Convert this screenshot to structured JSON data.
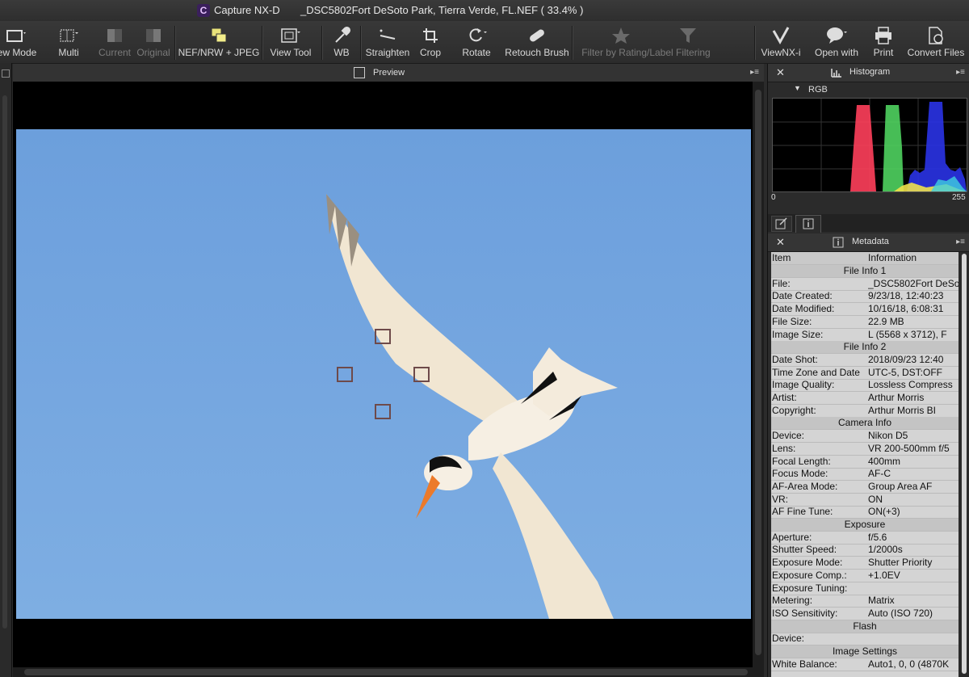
{
  "window": {
    "app_name": "Capture NX-D",
    "title": "_DSC5802Fort DeSoto Park, Tierra Verde, FL.NEF ( 33.4% )"
  },
  "toolbar": {
    "view_mode": "ew Mode",
    "multi": "Multi",
    "current": "Current",
    "original": "Original",
    "nef_jpeg": "NEF/NRW + JPEG",
    "view_tool": "View Tool",
    "wb": "WB",
    "straighten": "Straighten",
    "crop": "Crop",
    "rotate": "Rotate",
    "retouch_brush": "Retouch Brush",
    "filter": "Filter by Rating/Label Filtering",
    "viewnx": "ViewNX-i",
    "open_with": "Open with",
    "print": "Print",
    "convert_files": "Convert Files"
  },
  "preview": {
    "title": "Preview"
  },
  "histogram": {
    "title": "Histogram",
    "channel": "RGB",
    "min_label": "0",
    "max_label": "255"
  },
  "metadata": {
    "title": "Metadata",
    "col_item": "Item",
    "col_info": "Information",
    "rows": [
      {
        "section": "File Info 1"
      },
      {
        "k": "File:",
        "v": "_DSC5802Fort DeSo"
      },
      {
        "k": "Date Created:",
        "v": "9/23/18, 12:40:23"
      },
      {
        "k": "Date Modified:",
        "v": "10/16/18, 6:08:31"
      },
      {
        "k": "File Size:",
        "v": "22.9 MB"
      },
      {
        "k": "Image Size:",
        "v": "L (5568 x 3712), F"
      },
      {
        "section": "File Info 2"
      },
      {
        "k": "Date Shot:",
        "v": "2018/09/23 12:40"
      },
      {
        "k": "Time Zone and Date",
        "v": "UTC-5, DST:OFF"
      },
      {
        "k": "Image Quality:",
        "v": "Lossless Compress"
      },
      {
        "k": "Artist:",
        "v": "Arthur Morris"
      },
      {
        "k": "Copyright:",
        "v": "Arthur Morris     BI"
      },
      {
        "section": "Camera Info"
      },
      {
        "k": "Device:",
        "v": "Nikon D5"
      },
      {
        "k": "Lens:",
        "v": "VR 200-500mm f/5"
      },
      {
        "k": "Focal Length:",
        "v": "400mm"
      },
      {
        "k": "Focus Mode:",
        "v": "AF-C"
      },
      {
        "k": "AF-Area Mode:",
        "v": "Group Area AF"
      },
      {
        "k": "VR:",
        "v": "ON"
      },
      {
        "k": "AF Fine Tune:",
        "v": "ON(+3)"
      },
      {
        "section": "Exposure"
      },
      {
        "k": "Aperture:",
        "v": "f/5.6"
      },
      {
        "k": "Shutter Speed:",
        "v": "1/2000s"
      },
      {
        "k": "Exposure Mode:",
        "v": "Shutter Priority"
      },
      {
        "k": "Exposure Comp.:",
        "v": "+1.0EV"
      },
      {
        "k": "Exposure Tuning:",
        "v": ""
      },
      {
        "k": "Metering:",
        "v": "Matrix"
      },
      {
        "k": "ISO Sensitivity:",
        "v": "Auto (ISO 720)"
      },
      {
        "section": "Flash"
      },
      {
        "k": "Device:",
        "v": ""
      },
      {
        "section": "Image Settings"
      },
      {
        "k": "White Balance:",
        "v": "Auto1, 0, 0 (4870K"
      }
    ]
  }
}
